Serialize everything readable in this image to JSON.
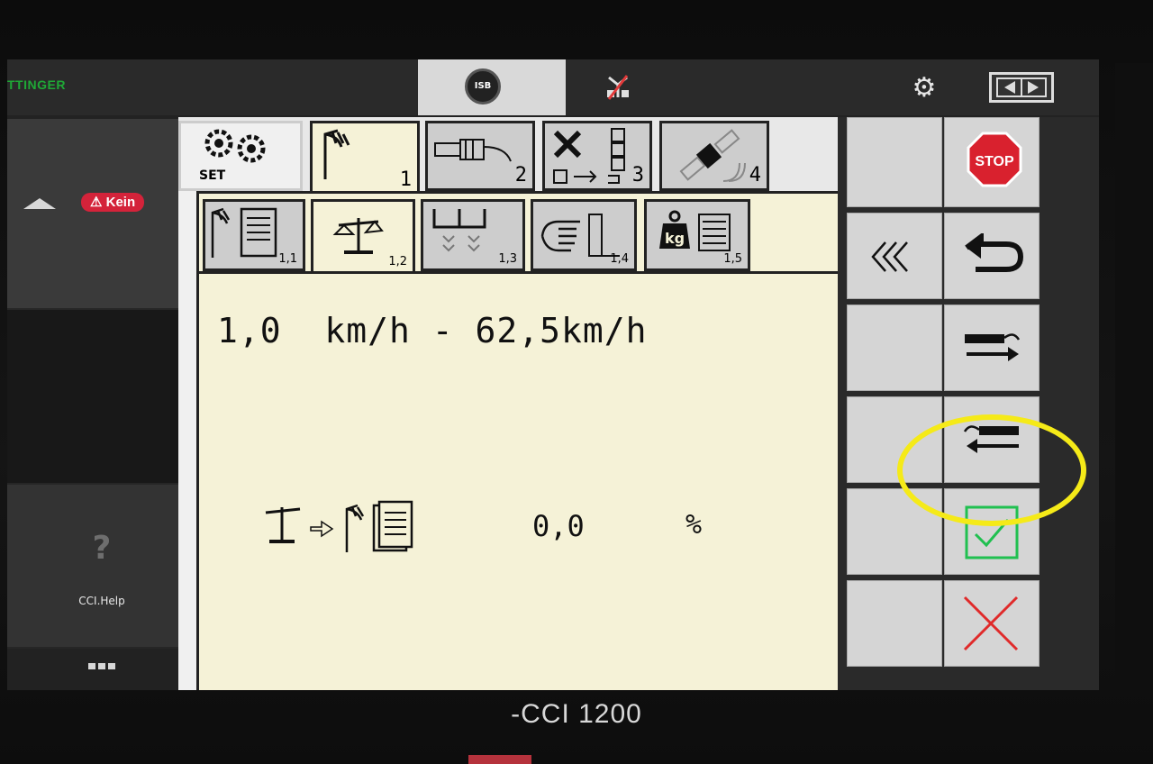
{
  "device": {
    "model": "-CCI 1200"
  },
  "topbar": {
    "brand": "TTINGER",
    "isb_label": "ISB",
    "settings_icon": "gear-icon",
    "swap_icon": "screen-swap-icon"
  },
  "left_panel": {
    "warning_badge": "Kein",
    "help_label": "CCI.Help",
    "help_symbol": "?"
  },
  "tabs_level1": [
    {
      "id": "set",
      "label": "SET",
      "icon": "gears-icon"
    },
    {
      "id": "1",
      "label": "1",
      "icon": "crop-icon",
      "active": true
    },
    {
      "id": "2",
      "label": "2",
      "icon": "sensor-icon"
    },
    {
      "id": "3",
      "label": "3",
      "icon": "tools-icon"
    },
    {
      "id": "4",
      "label": "4",
      "icon": "satellite-icon"
    }
  ],
  "tabs_level2": [
    {
      "id": "1.1",
      "label": "1,1",
      "icon": "crop-document-icon"
    },
    {
      "id": "1.2",
      "label": "1,2",
      "icon": "scale-icon",
      "active": true
    },
    {
      "id": "1.3",
      "label": "1,3",
      "icon": "hopper-icon"
    },
    {
      "id": "1.4",
      "label": "1,4",
      "icon": "hand-icon"
    },
    {
      "id": "1.5",
      "label": "1,5",
      "icon": "weight-kg-icon"
    }
  ],
  "content": {
    "speed_range": "1,0  km/h - 62,5km/h",
    "calibration_value": "0,0",
    "calibration_unit": "%",
    "kg_label": "kg"
  },
  "softkeys": {
    "stop_label": "STOP",
    "back_all_icon": "triple-chevron-left-icon",
    "return_icon": "return-arrow-icon",
    "forward_icon": "next-page-icon",
    "backward_icon": "previous-page-icon",
    "confirm_icon": "checkmark-icon",
    "cancel_icon": "cancel-x-icon"
  },
  "colors": {
    "panel_bg": "#f5f2d7",
    "stop_red": "#d9212e",
    "confirm_green": "#20c050",
    "cancel_red": "#e02a2a",
    "highlight_yellow": "#f5ea18",
    "brand_green": "#1fa836"
  }
}
